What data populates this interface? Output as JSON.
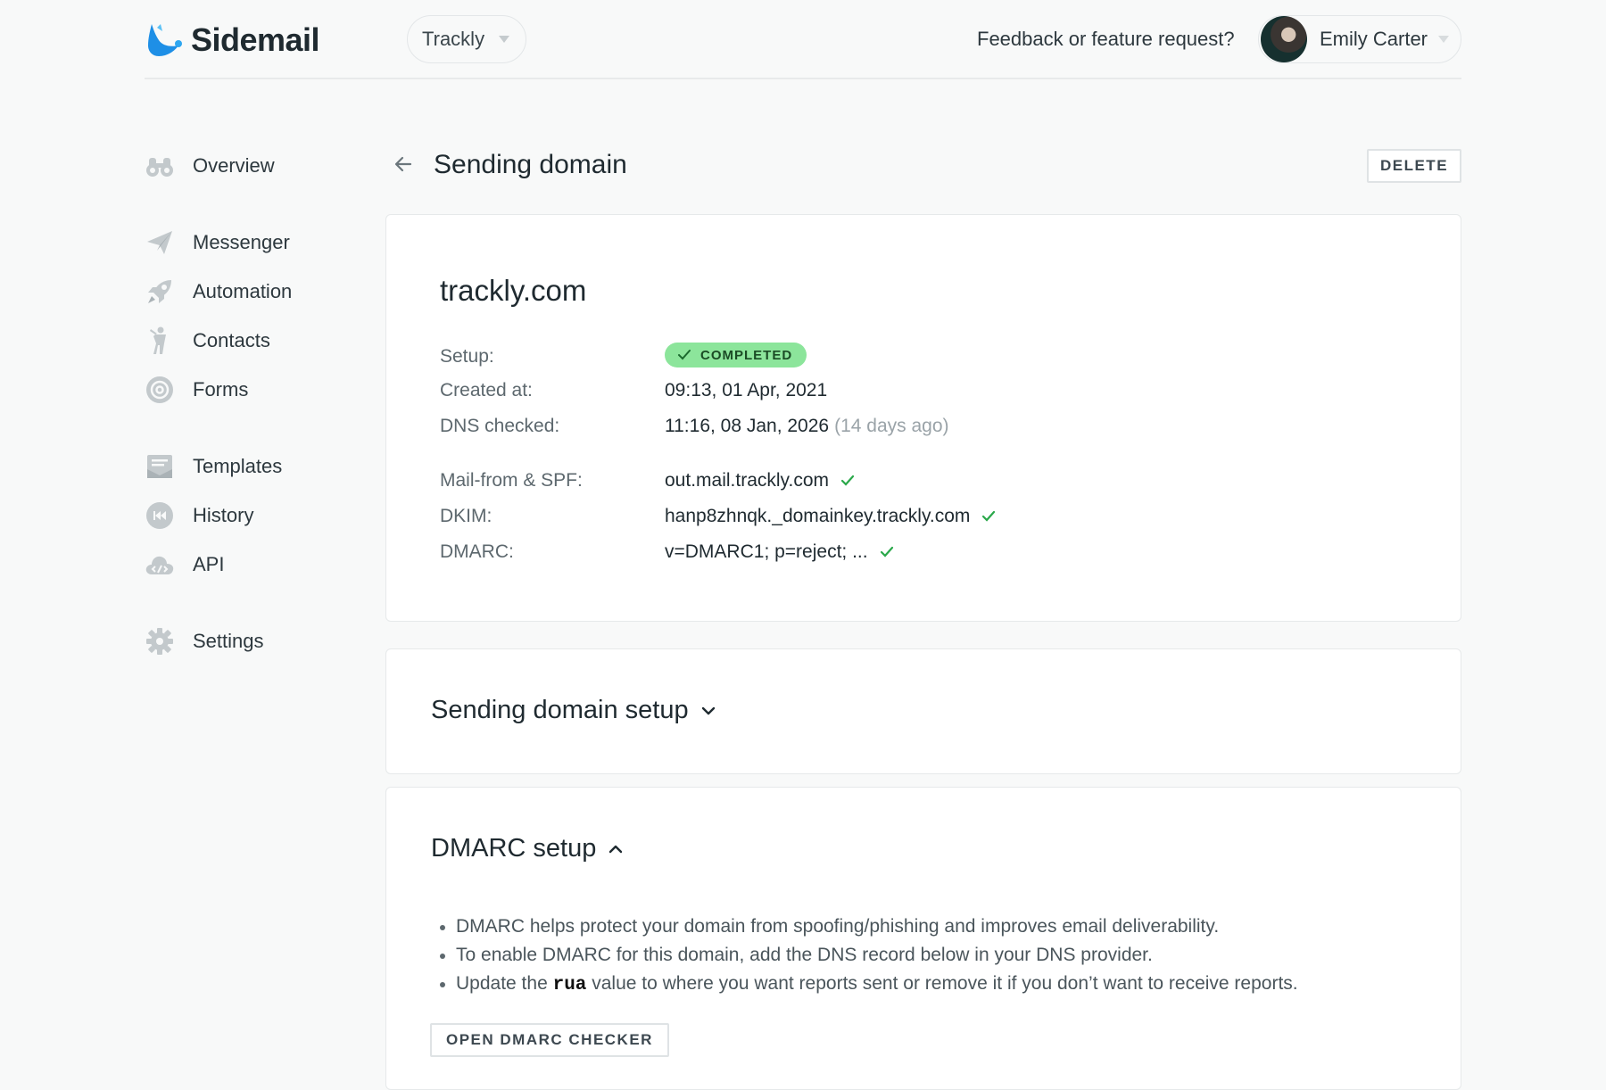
{
  "header": {
    "brand": "Sidemail",
    "project": "Trackly",
    "feedback": "Feedback or feature request?",
    "user_name": "Emily Carter"
  },
  "sidebar": {
    "items": [
      {
        "label": "Overview",
        "icon": "binoculars-icon"
      },
      {
        "label": "Messenger",
        "icon": "paper-plane-icon"
      },
      {
        "label": "Automation",
        "icon": "rocket-icon"
      },
      {
        "label": "Contacts",
        "icon": "person-icon"
      },
      {
        "label": "Forms",
        "icon": "at-sign-icon"
      },
      {
        "label": "Templates",
        "icon": "envelope-icon"
      },
      {
        "label": "History",
        "icon": "rewind-icon"
      },
      {
        "label": "API",
        "icon": "code-cloud-icon"
      },
      {
        "label": "Settings",
        "icon": "gear-icon"
      }
    ]
  },
  "page": {
    "title": "Sending domain",
    "delete_label": "DELETE"
  },
  "domain": {
    "name": "trackly.com",
    "setup_label": "Setup:",
    "setup_status": "COMPLETED",
    "created_label": "Created at:",
    "created_value": "09:13, 01 Apr, 2021",
    "dns_label": "DNS checked:",
    "dns_value": "11:16, 08 Jan, 2026",
    "dns_relative": "(14 days ago)",
    "mailfrom_label": "Mail-from & SPF:",
    "mailfrom_value": "out.mail.trackly.com",
    "dkim_label": "DKIM:",
    "dkim_value": "hanp8zhnqk._domainkey.trackly.com",
    "dmarc_label": "DMARC:",
    "dmarc_value": "v=DMARC1; p=reject; ..."
  },
  "sections": {
    "sending_setup_title": "Sending domain setup",
    "dmarc_setup_title": "DMARC setup",
    "dmarc_bullet_1": "DMARC helps protect your domain from spoofing/phishing and improves email deliverability.",
    "dmarc_bullet_2": "To enable DMARC for this domain, add the DNS record below in your DNS provider.",
    "dmarc_bullet_3_pre": "Update the ",
    "dmarc_bullet_3_code": "rua",
    "dmarc_bullet_3_post": " value to where you want reports sent or remove it if you don’t want to receive reports.",
    "dmarc_checker_label": "OPEN DMARC CHECKER"
  },
  "colors": {
    "brand_blue": "#2ea6f0",
    "success_green": "#8ce59b",
    "check_green": "#2aa84a",
    "icon_gray": "#c3c9cc"
  }
}
